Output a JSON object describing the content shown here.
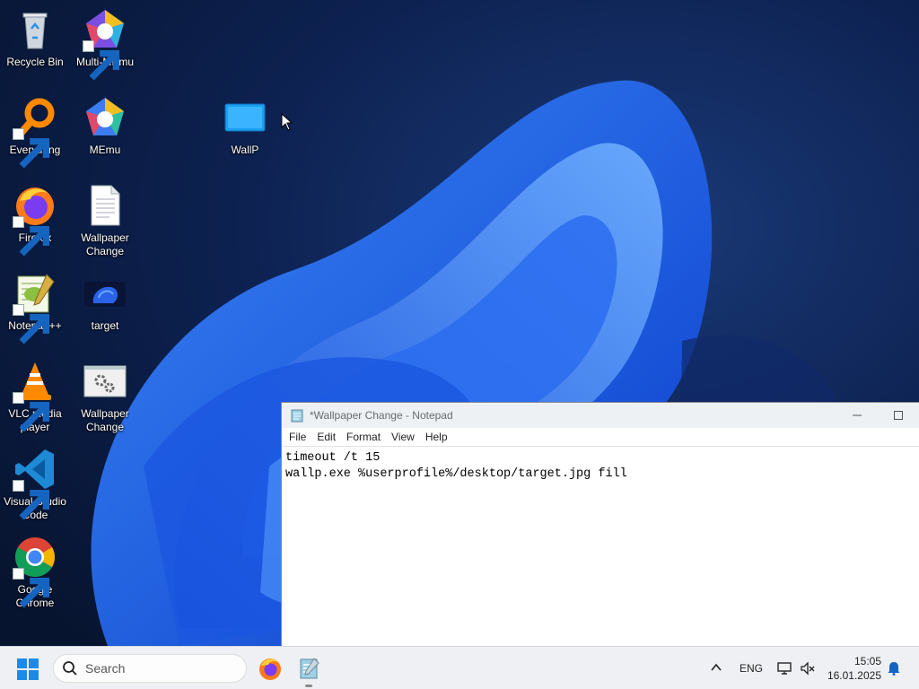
{
  "desktop": {
    "icons": [
      {
        "label": "Recycle Bin"
      },
      {
        "label": "Multi-MEmu"
      },
      {
        "label": "Everything"
      },
      {
        "label": "MEmu"
      },
      {
        "label": "WallP"
      },
      {
        "label": "Firefox"
      },
      {
        "label": "Wallpaper Change"
      },
      {
        "label": "Notepad++"
      },
      {
        "label": "target"
      },
      {
        "label": "VLC media player"
      },
      {
        "label": "Wallpaper Change"
      },
      {
        "label": "Visual Studio Code"
      },
      {
        "label": "Google Chrome"
      }
    ]
  },
  "notepad": {
    "title": "*Wallpaper Change - Notepad",
    "menu": [
      "File",
      "Edit",
      "Format",
      "View",
      "Help"
    ],
    "lines": [
      "timeout /t 15",
      "wallp.exe %userprofile%/desktop/target.jpg fill"
    ]
  },
  "taskbar": {
    "search_placeholder": "Search",
    "language": "ENG",
    "time": "15:05",
    "date": "16.01.2025"
  },
  "colors": {
    "taskbar_bg": "#eef0f3",
    "accent_blue": "#1e6fe6",
    "wallpaper_dark": "#0a1a3a"
  }
}
